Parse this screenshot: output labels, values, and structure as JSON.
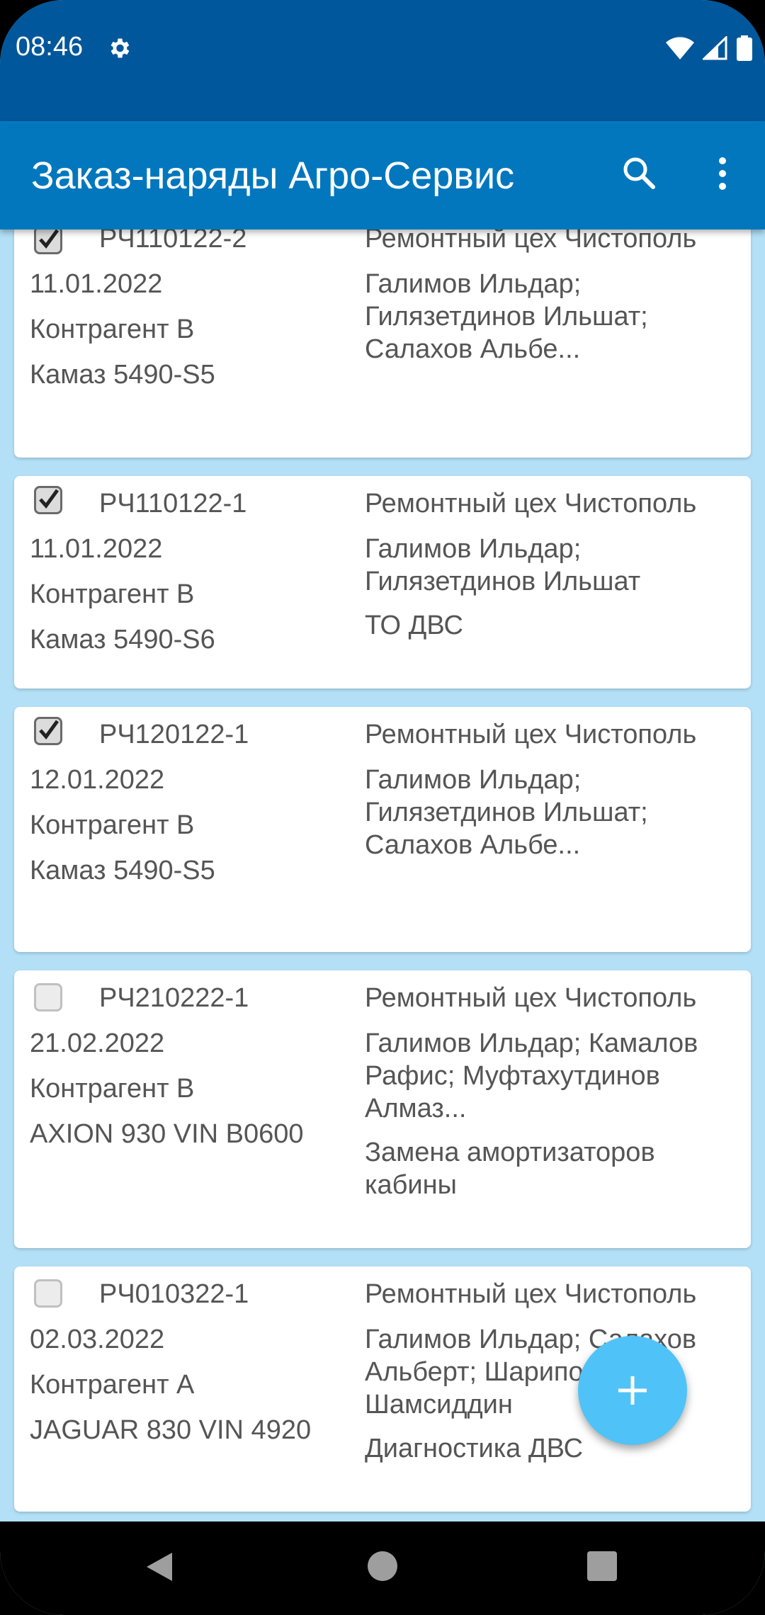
{
  "status": {
    "time": "08:46"
  },
  "appbar": {
    "title": "Заказ-наряды Агро-Сервис"
  },
  "orders": [
    {
      "number": "РЧ110122-2",
      "date": "11.01.2022",
      "contractor": "Контрагент В",
      "vehicle": "Камаз 5490-S5",
      "workshop": "Ремонтный цех Чистополь",
      "workers": "Галимов Ильдар; Гилязетдинов Ильшат; Салахов Альбе...",
      "description": "",
      "checked": true
    },
    {
      "number": "РЧ110122-1",
      "date": "11.01.2022",
      "contractor": "Контрагент В",
      "vehicle": "Камаз 5490-S6",
      "workshop": "Ремонтный цех Чистополь",
      "workers": "Галимов Ильдар; Гилязетдинов Ильшат",
      "description": "ТО ДВС",
      "checked": true
    },
    {
      "number": "РЧ120122-1",
      "date": "12.01.2022",
      "contractor": "Контрагент В",
      "vehicle": "Камаз 5490-S5",
      "workshop": "Ремонтный цех Чистополь",
      "workers": "Галимов Ильдар; Гилязетдинов Ильшат; Салахов Альбе...",
      "description": "",
      "checked": true
    },
    {
      "number": "РЧ210222-1",
      "date": "21.02.2022",
      "contractor": "Контрагент В",
      "vehicle": "AXION 930 VIN B0600",
      "workshop": "Ремонтный цех Чистополь",
      "workers": "Галимов Ильдар; Камалов Рафис; Муфтахутдинов Алмаз...",
      "description": "Замена амортизаторов кабины",
      "checked": false
    },
    {
      "number": "РЧ010322-1",
      "date": "02.03.2022",
      "contractor": "Контрагент А",
      "vehicle": "JAGUAR 830 VIN 4920",
      "workshop": "Ремонтный цех Чистополь",
      "workers": "Галимов Ильдар; Салахов Альберт; Шарипов Шамсиддин",
      "description": "Диагностика ДВС",
      "checked": false
    }
  ],
  "colors": {
    "status_bar": "#01579b",
    "app_bar": "#0277bd",
    "list_background": "#b3e0f7",
    "fab": "#4fc3f7",
    "text": "#555555"
  },
  "icons": [
    "gear-icon",
    "wifi-icon",
    "signal-icon",
    "battery-icon",
    "search-icon",
    "more-vert-icon",
    "add-icon",
    "back-icon",
    "home-icon",
    "recents-icon"
  ]
}
